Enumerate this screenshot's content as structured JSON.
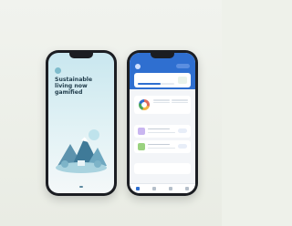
{
  "onboarding": {
    "title": "Sustainable living now gamified"
  },
  "colors": {
    "background": "#eef1ea",
    "dashboard_header": "#2f6fd0",
    "onboarding_sky": "#c9e7ef"
  }
}
